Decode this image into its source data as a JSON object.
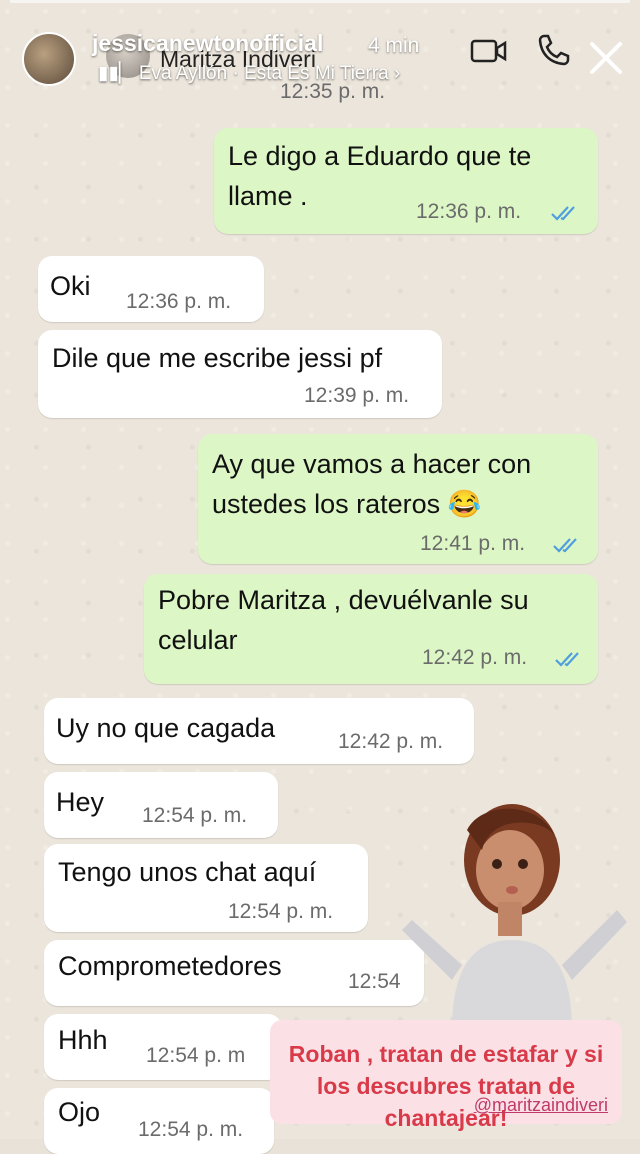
{
  "story": {
    "username": "jessicanewtonofficial",
    "time_ago": "4 min",
    "music": "Eva Ayllón · Esta Es Mi Tierra",
    "icons": [
      "video-camera-icon",
      "phone-icon",
      "close-icon"
    ]
  },
  "chat": {
    "contact_name": "Maritza Indiveri",
    "top_time": "12:35 p. m.",
    "messages": [
      {
        "dir": "out",
        "text": "Le digo a Eduardo que te\nllame .",
        "time": "12:36 p. m."
      },
      {
        "dir": "in",
        "text": "Oki",
        "time": "12:36 p. m."
      },
      {
        "dir": "in",
        "text": "Dile que me escribe jessi pf",
        "time": "12:39 p. m."
      },
      {
        "dir": "out",
        "text": "Ay que vamos a hacer con\nustedes los rateros 😂",
        "time": "12:41 p. m."
      },
      {
        "dir": "out",
        "text": "Pobre Maritza , devuélvanle su\ncelular",
        "time": "12:42 p. m."
      },
      {
        "dir": "in",
        "text": "Uy no que cagada",
        "time": "12:42 p. m."
      },
      {
        "dir": "in",
        "text": "Hey",
        "time": "12:54 p. m."
      },
      {
        "dir": "in",
        "text": "Tengo unos chat aquí",
        "time": "12:54 p. m."
      },
      {
        "dir": "in",
        "text": "Comprometedores",
        "time": "12:54"
      },
      {
        "dir": "in",
        "text": "Hhh",
        "time": "12:54 p. m"
      },
      {
        "dir": "in",
        "text": "Ojo",
        "time": "12:54 p. m."
      }
    ]
  },
  "sticker": {
    "text": "Roban , tratan de estafar y si los descubres tratan de chantajear!",
    "handle": "@maritzaindiveri"
  },
  "colors": {
    "incoming_bubble": "#ffffff",
    "outgoing_bubble": "#dcf7c5",
    "read_ticks": "#4f9fe0",
    "sticker_text": "#d83a4a"
  }
}
